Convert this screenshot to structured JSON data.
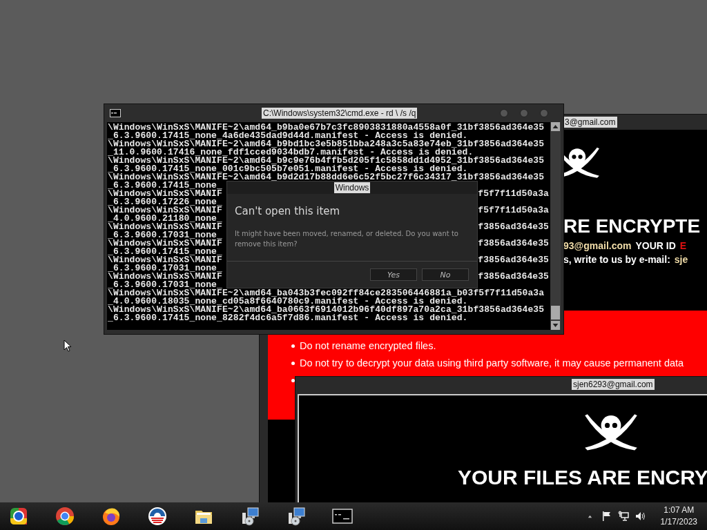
{
  "back_window": {
    "title": "3@gmail.com",
    "heading": "RE ENCRYPTE",
    "contact_line": {
      "email": "93@gmail.com",
      "id_label": "YOUR ID",
      "id_value": "E"
    },
    "write_line": {
      "text": "s, write to us by e-mail:",
      "email": "sje"
    },
    "warnings": [
      "Do not rename encrypted files.",
      "Do not try to decrypt your data using third party software, it may cause permanent data"
    ]
  },
  "front_window": {
    "title": "sjen6293@gmail.com",
    "heading": "YOUR FILES ARE ENCRY"
  },
  "cmd_window": {
    "title": "C:\\Windows\\system32\\cmd.exe - rd \\ /s /q",
    "lines": [
      {
        "left": "\\Windows\\WinSxS\\MANIFE~2\\amd64_b9ba0e67b7c3fc8903831880a4558a0f_31bf3856ad364e35"
      },
      {
        "left": "_6.3.9600.17415_none_4a6de435dad9d44d.manifest - Access is denied."
      },
      {
        "left": "\\Windows\\WinSxS\\MANIFE~2\\amd64_b9bd1bc3e5b851bba248a3c5a83e74eb_31bf3856ad364e35"
      },
      {
        "left": "_11.0.9600.17416_none_fdf1cced9034bdb7.manifest - Access is denied."
      },
      {
        "left": "\\Windows\\WinSxS\\MANIFE~2\\amd64_b9c9e76b4ffb5d205f1c5858dd1d4952_31bf3856ad364e35"
      },
      {
        "left": "_6.3.9600.17415_none_001c9bc505b7e051.manifest - Access is denied."
      },
      {
        "left": "\\Windows\\WinSxS\\MANIFE~2\\amd64_b9d2d17b88dd6e6c52f5bc27f6c34317_31bf3856ad364e35"
      },
      {
        "left": "_6.3.9600.17415_none_"
      },
      {
        "left": "\\Windows\\WinSxS\\MANIF",
        "right": "f5f7f11d50a3a"
      },
      {
        "left": "_6.3.9600.17226_none_"
      },
      {
        "left": "\\Windows\\WinSxS\\MANIF",
        "right": "f5f7f11d50a3a"
      },
      {
        "left": "_4.0.9600.21180_none_"
      },
      {
        "left": "\\Windows\\WinSxS\\MANIF",
        "right": "f3856ad364e35"
      },
      {
        "left": "_6.3.9600.17031_none_"
      },
      {
        "left": "\\Windows\\WinSxS\\MANIF",
        "right": "f3856ad364e35"
      },
      {
        "left": "_6.3.9600.17415_none_"
      },
      {
        "left": "\\Windows\\WinSxS\\MANIF",
        "right": "f3856ad364e35"
      },
      {
        "left": "_6.3.9600.17031_none_"
      },
      {
        "left": "\\Windows\\WinSxS\\MANIF",
        "right": "f3856ad364e35"
      },
      {
        "left": "_6.3.9600.17031_none_"
      },
      {
        "left": "\\Windows\\WinSxS\\MANIFE~2\\amd64_ba043b3fec092ff84ce283506446881a_b03f5f7f11d50a3a"
      },
      {
        "left": "_4.0.9600.18035_none_cd05a8f6640780c9.manifest - Access is denied."
      },
      {
        "left": "\\Windows\\WinSxS\\MANIFE~2\\amd64_ba0663f6914012b96f40df897a70a2ca_31bf3856ad364e35"
      },
      {
        "left": "_6.3.9600.17415_none_8282f4dc6a5f7d86.manifest - Access is denied."
      }
    ]
  },
  "dialog": {
    "title": "Windows",
    "heading": "Can't open this item",
    "message": "It might have been moved, renamed, or deleted. Do you want to remove this item?",
    "buttons": [
      "Yes",
      "No"
    ]
  },
  "taskbar": {
    "clock": {
      "time": "1:07 AM",
      "date": "1/17/2023"
    }
  }
}
